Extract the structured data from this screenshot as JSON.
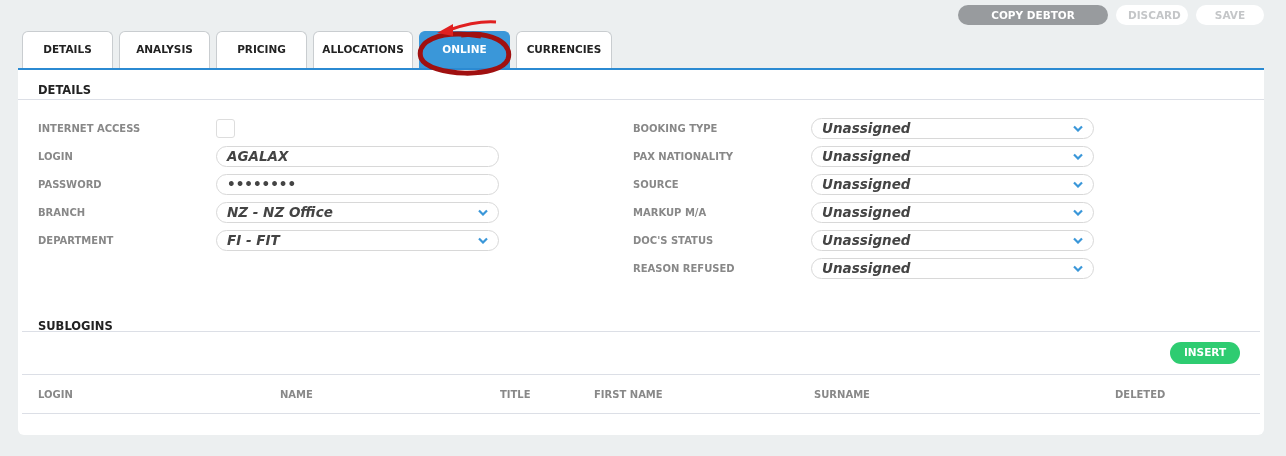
{
  "actions": [
    {
      "label": "COPY DEBTOR",
      "disabled": false
    },
    {
      "label": "DISCARD",
      "disabled": true
    },
    {
      "label": "SAVE",
      "disabled": true
    }
  ],
  "tabs": [
    {
      "label": "DETAILS",
      "selected": false,
      "circled": false
    },
    {
      "label": "ANALYSIS",
      "selected": false,
      "circled": false
    },
    {
      "label": "PRICING",
      "selected": false,
      "circled": false
    },
    {
      "label": "ALLOCATIONS",
      "selected": false,
      "circled": false
    },
    {
      "label": "ONLINE",
      "selected": true,
      "circled": true
    },
    {
      "label": "CURRENCIES",
      "selected": false,
      "circled": false
    }
  ],
  "details": {
    "title": "DETAILS",
    "left_fields": [
      {
        "label": "INTERNET ACCESS",
        "kind": "checkbox",
        "checked": false
      },
      {
        "label": "LOGIN",
        "kind": "text",
        "value": "AGALAX"
      },
      {
        "label": "PASSWORD",
        "kind": "text",
        "value": "••••••••"
      },
      {
        "label": "BRANCH",
        "kind": "select",
        "value": "NZ - NZ Office"
      },
      {
        "label": "DEPARTMENT",
        "kind": "select",
        "value": "FI - FIT"
      }
    ],
    "right_fields": [
      {
        "label": "BOOKING TYPE",
        "kind": "select",
        "value": "Unassigned"
      },
      {
        "label": "PAX NATIONALITY",
        "kind": "select",
        "value": "Unassigned"
      },
      {
        "label": "SOURCE",
        "kind": "select",
        "value": "Unassigned"
      },
      {
        "label": "MARKUP M/A",
        "kind": "select",
        "value": "Unassigned"
      },
      {
        "label": "DOC'S STATUS",
        "kind": "select",
        "value": "Unassigned"
      },
      {
        "label": "REASON REFUSED",
        "kind": "select",
        "value": "Unassigned"
      }
    ]
  },
  "sublogins": {
    "title": "SUBLOGINS",
    "insert_button": "INSERT",
    "columns": [
      "LOGIN",
      "NAME",
      "TITLE",
      "FIRST NAME",
      "SURNAME",
      "DELETED"
    ]
  }
}
